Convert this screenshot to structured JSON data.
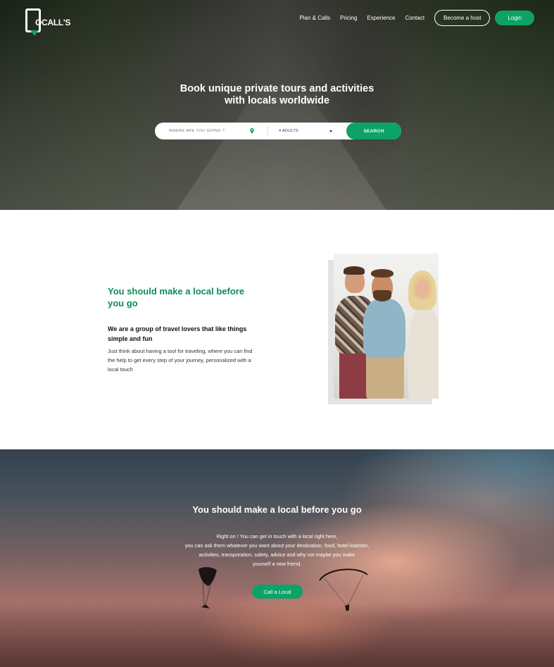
{
  "brand": {
    "logo_text": "OCALL'S",
    "accent": "#0da366"
  },
  "nav": {
    "links": [
      "Plan & Calls",
      "Pricing",
      "Experience",
      "Contact"
    ],
    "become_host": "Become a host",
    "login": "Login"
  },
  "hero": {
    "title_line1": "Book unique private tours and activities",
    "title_line2": "with locals worldwide",
    "search_placeholder": "WHERE ARE YOU GOING ?",
    "adults": "4 ADULTS",
    "search_button": "SEARCH"
  },
  "about": {
    "title": "You should make a local before you go",
    "subtitle": "We are a group of travel lovers that like things simple and fun",
    "body": "Just think about having a tool for traveling, where you can find the help to get every step of your journey, personalized with a local touch"
  },
  "cta": {
    "title": "You should make a local before you go",
    "lines": [
      "Right on ! You can get in touch with a local right here,",
      "you can ask them whatever you want about your destination, food, hotel loaction,",
      "activities, transporation, safety, advice and why not maybe you make",
      "yourself a new friend."
    ],
    "button": "Call a Local"
  }
}
